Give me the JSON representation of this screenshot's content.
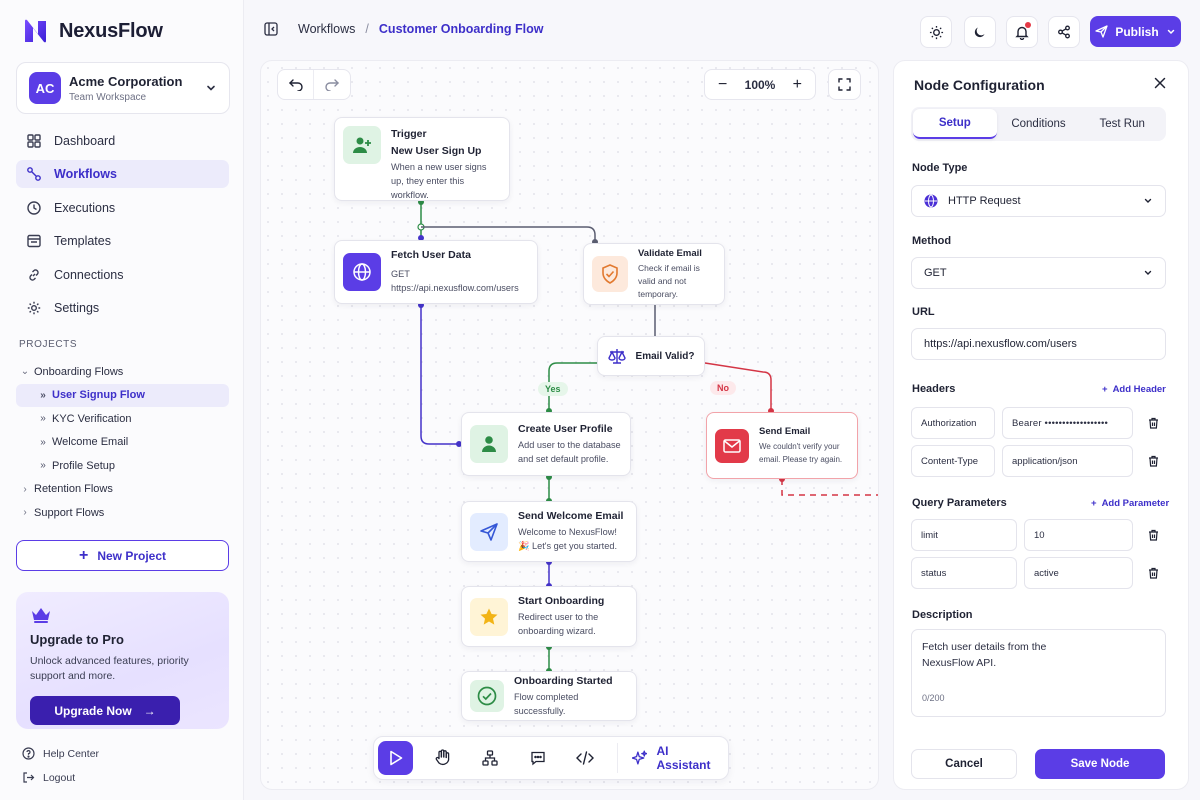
{
  "brand": {
    "name": "NexusFlow"
  },
  "workspace": {
    "initials": "AC",
    "name": "Acme Corporation",
    "subtitle": "Team Workspace"
  },
  "nav": [
    {
      "label": "Dashboard",
      "icon": "grid-icon"
    },
    {
      "label": "Workflows",
      "icon": "workflow-icon",
      "active": true
    },
    {
      "label": "Executions",
      "icon": "clock-icon"
    },
    {
      "label": "Templates",
      "icon": "template-icon"
    },
    {
      "label": "Connections",
      "icon": "link-icon"
    },
    {
      "label": "Settings",
      "icon": "gear-icon"
    }
  ],
  "projects": {
    "heading": "PROJECTS",
    "tree": [
      {
        "label": "Onboarding Flows",
        "expanded": true
      },
      {
        "label": "User Signup Flow",
        "active": true
      },
      {
        "label": "KYC Verification"
      },
      {
        "label": "Welcome Email"
      },
      {
        "label": "Profile Setup"
      },
      {
        "label": "Retention Flows"
      },
      {
        "label": "Support Flows"
      }
    ],
    "new_project": "New Project"
  },
  "upgrade": {
    "title": "Upgrade to Pro",
    "description": "Unlock advanced features, priority support and more.",
    "button": "Upgrade Now"
  },
  "footer": {
    "help": "Help Center",
    "logout": "Logout"
  },
  "breadcrumb": {
    "root": "Workflows",
    "separator": "/",
    "current": "Customer Onboarding Flow"
  },
  "topbar": {
    "publish": "Publish"
  },
  "canvas": {
    "zoom": "100%",
    "nodes": {
      "trigger": {
        "kicker": "Trigger",
        "title": "New User Sign Up",
        "desc": "When a new user signs up, they enter this workflow."
      },
      "fetch": {
        "title": "Fetch User Data",
        "desc": "GET https://api.nexusflow.com/users"
      },
      "validate": {
        "title": "Validate Email",
        "desc": "Check if email is valid and not temporary."
      },
      "decision": {
        "title": "Email Valid?"
      },
      "yes": "Yes",
      "no": "No",
      "create": {
        "title": "Create User Profile",
        "desc": "Add user to the database and set default profile."
      },
      "send_err": {
        "title": "Send Email",
        "desc": "We couldn't verify your email. Please try again."
      },
      "welcome": {
        "title": "Send Welcome Email",
        "desc": "Welcome to NexusFlow! 🎉 Let's get you started."
      },
      "start": {
        "title": "Start Onboarding",
        "desc": "Redirect user to the onboarding wizard."
      },
      "done": {
        "title": "Onboarding Started",
        "desc": "Flow completed successfully."
      }
    },
    "dock": {
      "ai_label": "AI Assistant"
    }
  },
  "panel": {
    "title": "Node Configuration",
    "tabs": [
      "Setup",
      "Conditions",
      "Test Run"
    ],
    "active_tab": "Setup",
    "node_type_label": "Node Type",
    "node_type": "HTTP Request",
    "method_label": "Method",
    "method": "GET",
    "url_label": "URL",
    "url": "https://api.nexusflow.com/users",
    "headers_label": "Headers",
    "add_header": "Add Header",
    "headers": [
      {
        "key": "Authorization",
        "value": "Bearer ••••••••••••••••••"
      },
      {
        "key": "Content-Type",
        "value": "application/json"
      }
    ],
    "query_label": "Query Parameters",
    "add_param": "Add Parameter",
    "params": [
      {
        "key": "limit",
        "value": "10"
      },
      {
        "key": "status",
        "value": "active"
      }
    ],
    "description_label": "Description",
    "description": "Fetch user details from the NexusFlow API.",
    "description_count": "0/200",
    "cancel": "Cancel",
    "save": "Save Node"
  },
  "colors": {
    "accent": "#5B3DE6",
    "success": "#2D8C46",
    "danger": "#E53946"
  }
}
